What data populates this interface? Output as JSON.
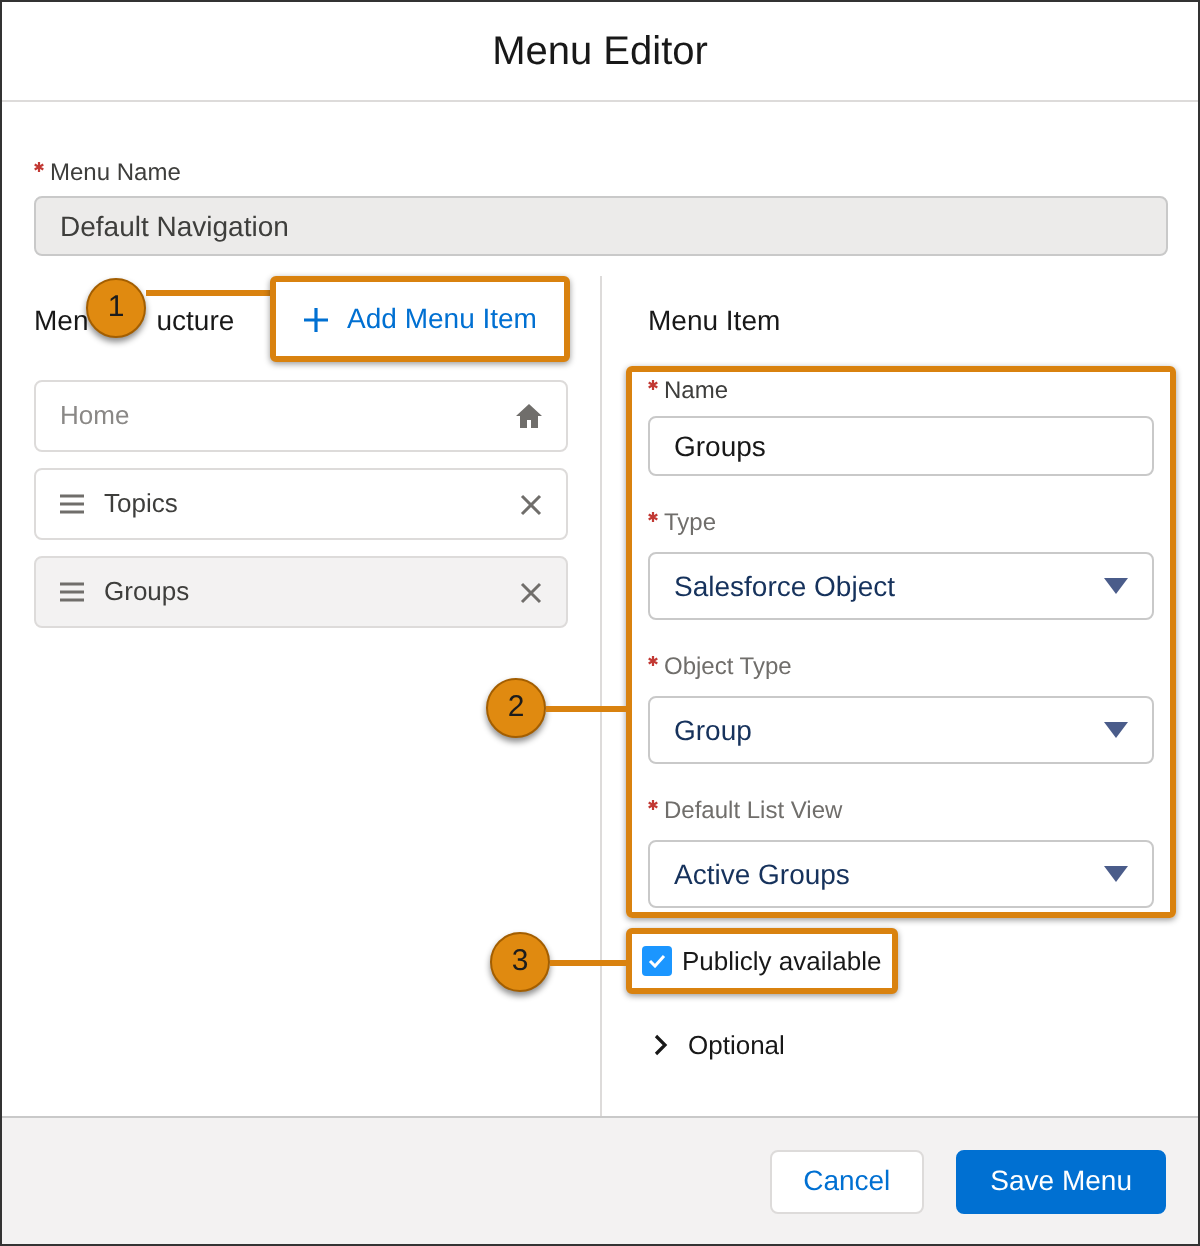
{
  "dialog": {
    "title": "Menu Editor"
  },
  "menu_name": {
    "label": "Menu Name",
    "required": true,
    "value": "Default Navigation"
  },
  "menu_structure": {
    "label_parts": [
      "Men",
      "ucture"
    ],
    "add_button": "Add Menu Item",
    "items": [
      {
        "kind": "home",
        "label": "Home",
        "selected": false
      },
      {
        "kind": "item",
        "label": "Topics",
        "selected": false
      },
      {
        "kind": "item",
        "label": "Groups",
        "selected": true
      }
    ]
  },
  "menu_item": {
    "heading": "Menu Item",
    "fields": [
      {
        "kind": "text",
        "label": "Name",
        "required": true,
        "value": "Groups"
      },
      {
        "kind": "select",
        "label": "Type",
        "required": true,
        "value": "Salesforce Object"
      },
      {
        "kind": "select",
        "label": "Object Type",
        "required": true,
        "value": "Group"
      },
      {
        "kind": "select",
        "label": "Default List View",
        "required": true,
        "value": "Active Groups"
      }
    ],
    "publicly_available": {
      "label": "Publicly available",
      "checked": true
    },
    "optional": {
      "label": "Optional",
      "expanded": false
    }
  },
  "callouts": [
    {
      "number": "1"
    },
    {
      "number": "2"
    },
    {
      "number": "3"
    }
  ],
  "footer": {
    "buttons": [
      {
        "label": "Cancel",
        "kind": "secondary"
      },
      {
        "label": "Save Menu",
        "kind": "primary"
      }
    ]
  }
}
